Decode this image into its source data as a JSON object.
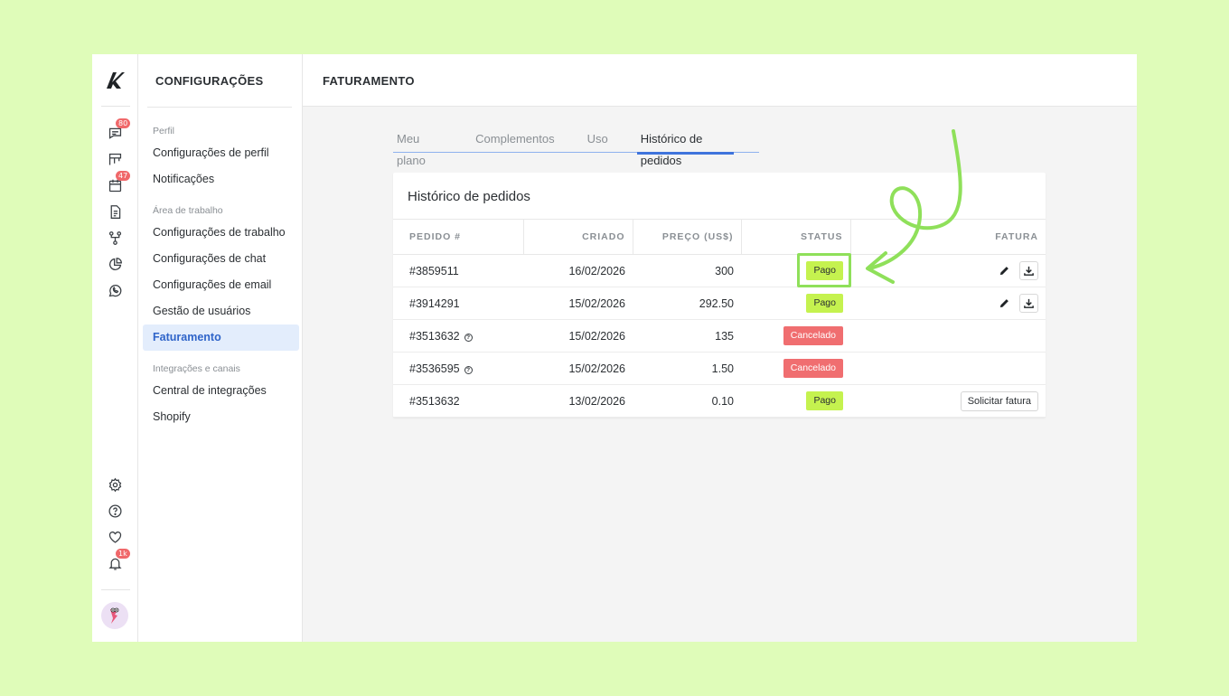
{
  "rail": {
    "badges": {
      "chat": "80",
      "calendar": "47",
      "notifications": "1k"
    }
  },
  "sidebar": {
    "title": "CONFIGURAÇÕES",
    "sections": [
      {
        "label": "Perfil",
        "items": [
          "Configurações de perfil",
          "Notificações"
        ]
      },
      {
        "label": "Área de trabalho",
        "items": [
          "Configurações de trabalho",
          "Configurações de chat",
          "Configurações de email",
          "Gestão de usuários",
          "Faturamento"
        ]
      },
      {
        "label": "Integrações e canais",
        "items": [
          "Central de integrações",
          "Shopify"
        ]
      }
    ],
    "active_item": "Faturamento"
  },
  "header": {
    "title": "FATURAMENTO"
  },
  "tabs": [
    "Meu plano",
    "Complementos",
    "Uso",
    "Histórico de pedidos"
  ],
  "active_tab": "Histórico de pedidos",
  "card": {
    "title": "Histórico de pedidos",
    "columns": [
      "PEDIDO #",
      "CRIADO",
      "PREÇO (US$)",
      "STATUS",
      "FATURA"
    ],
    "rows": [
      {
        "order": "#3859511",
        "created": "16/02/2026",
        "price": "300",
        "status": "Pago",
        "status_type": "paid",
        "invoice": "actions"
      },
      {
        "order": "#3914291",
        "created": "15/02/2026",
        "price": "292.50",
        "status": "Pago",
        "status_type": "paid",
        "invoice": "actions"
      },
      {
        "order": "#3513632",
        "created": "15/02/2026",
        "price": "135",
        "status": "Cancelado",
        "status_type": "cancelled",
        "invoice": "none",
        "help": true
      },
      {
        "order": "#3536595",
        "created": "15/02/2026",
        "price": "1.50",
        "status": "Cancelado",
        "status_type": "cancelled",
        "invoice": "none",
        "help": true
      },
      {
        "order": "#3513632",
        "created": "13/02/2026",
        "price": "0.10",
        "status": "Pago",
        "status_type": "paid",
        "invoice": "request",
        "invoice_label": "Solicitar fatura"
      }
    ]
  },
  "colors": {
    "accent": "#3f74dc",
    "paid": "#c5f24f",
    "cancelled": "#f06e70",
    "annotation": "#8fe05a",
    "background": "#dffcb9"
  }
}
